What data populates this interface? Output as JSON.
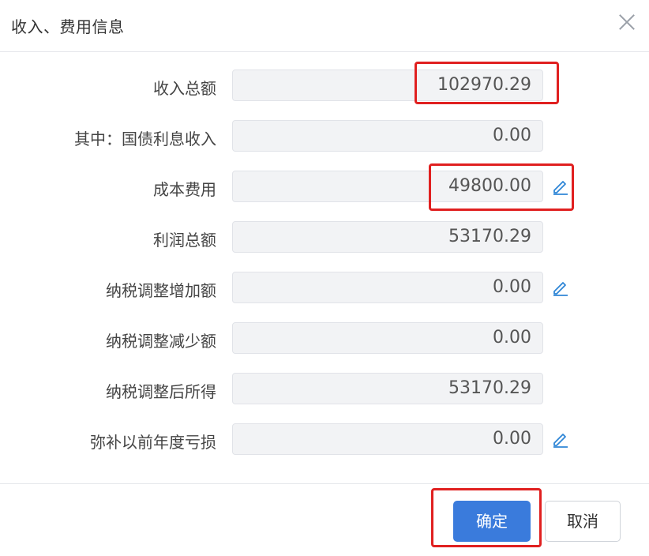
{
  "dialog": {
    "title": "收入、费用信息",
    "close_icon": "close-icon"
  },
  "fields": [
    {
      "label": "收入总额",
      "value": "102970.29",
      "editable": false,
      "highlighted": true
    },
    {
      "label": "其中：国债利息收入",
      "value": "0.00",
      "editable": false,
      "highlighted": false
    },
    {
      "label": "成本费用",
      "value": "49800.00",
      "editable": true,
      "highlighted": true
    },
    {
      "label": "利润总额",
      "value": "53170.29",
      "editable": false,
      "highlighted": false
    },
    {
      "label": "纳税调整增加额",
      "value": "0.00",
      "editable": true,
      "highlighted": false
    },
    {
      "label": "纳税调整减少额",
      "value": "0.00",
      "editable": false,
      "highlighted": false
    },
    {
      "label": "纳税调整后所得",
      "value": "53170.29",
      "editable": false,
      "highlighted": false
    },
    {
      "label": "弥补以前年度亏损",
      "value": "0.00",
      "editable": true,
      "highlighted": false
    }
  ],
  "buttons": {
    "confirm": "确定",
    "cancel": "取消"
  },
  "colors": {
    "primary": "#3a7bdc",
    "highlight": "#e02020",
    "edit_icon": "#2f86d6",
    "field_bg": "#f2f3f5"
  }
}
